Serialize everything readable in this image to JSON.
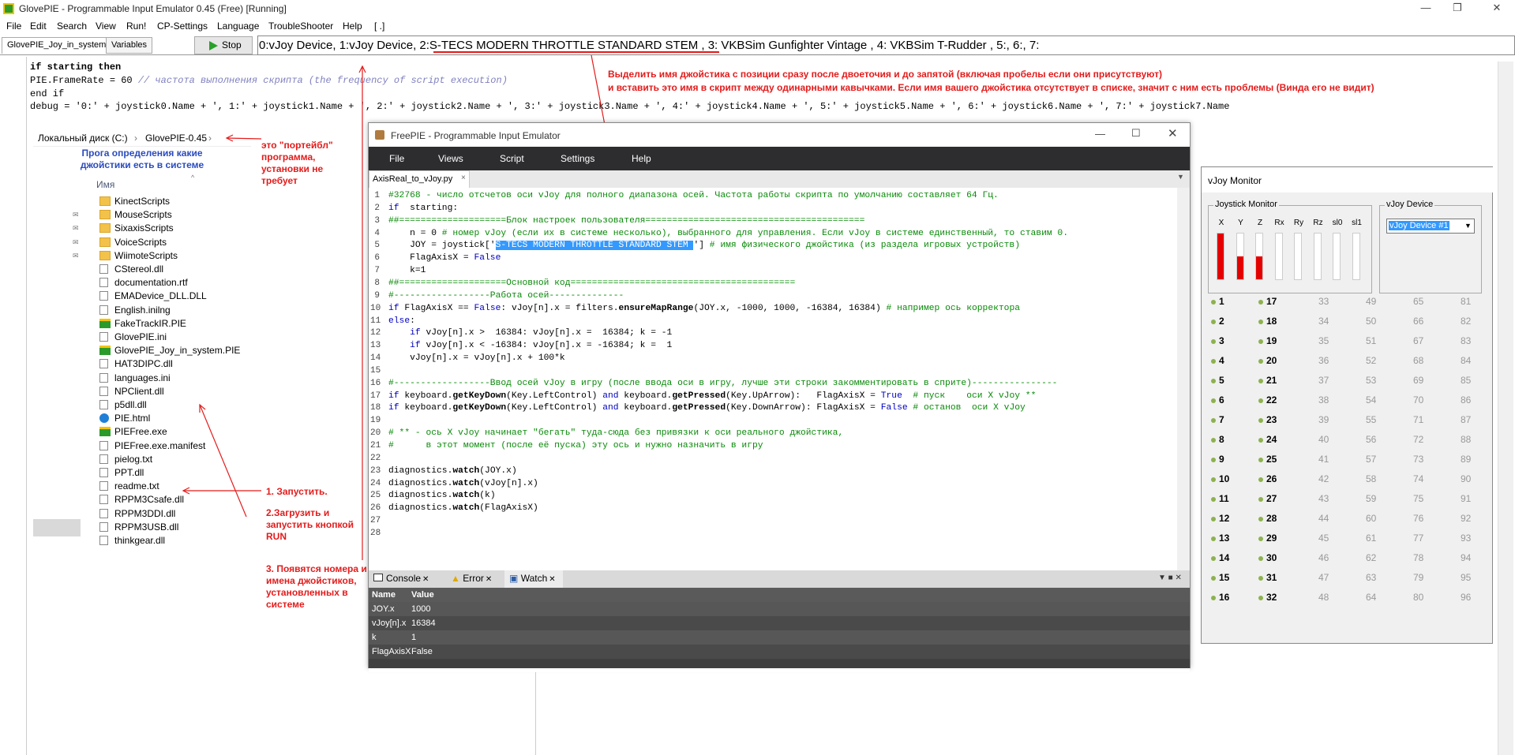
{
  "app": {
    "title": "GlovePIE - Programmable Input Emulator 0.45 (Free) [Running]",
    "menu": [
      "File",
      "Edit",
      "Search",
      "View",
      "Run!",
      "CP-Settings",
      "Language",
      "TroubleShooter",
      "Help",
      "[ .]"
    ],
    "tabs": [
      "GlovePIE_Joy_in_system",
      "Variables"
    ],
    "stop_label": "Stop",
    "debug_output": "0:vJoy Device, 1:vJoy Device, 2:S-TECS MODERN THROTTLE STANDARD STEM , 3: VKBSim Gunfighter Vintage , 4: VKBSim T-Rudder , 5:, 6:, 7:",
    "script_lines": [
      "if starting then",
      "PIE.FrameRate = 60 // частота выполнения скрипта (the frequency of script execution)",
      "end if",
      "debug = '0:' + joystick0.Name + ', 1:' + joystick1.Name + ', 2:' + joystick2.Name + ', 3:' + joystick3.Name + ', 4:' + joystick4.Name + ', 5:' + joystick5.Name + ', 6:' + joystick6.Name + ', 7:' + joystick7.Name"
    ]
  },
  "explorer": {
    "breadcrumb": [
      "Локальный диск (C:)",
      "GlovePIE-0.45"
    ],
    "column_header": "Имя",
    "items": [
      "KinectScripts",
      "MouseScripts",
      "SixaxisScripts",
      "VoiceScripts",
      "WiimoteScripts",
      "CStereol.dll",
      "documentation.rtf",
      "EMADevice_DLL.DLL",
      "English.inilng",
      "FakeTrackIR.PIE",
      "GlovePIE.ini",
      "GlovePIE_Joy_in_system.PIE",
      "HAT3DIPC.dll",
      "languages.ini",
      "NPClient.dll",
      "p5dll.dll",
      "PIE.html",
      "PIEFree.exe",
      "PIEFree.exe.manifest",
      "pielog.txt",
      "PPT.dll",
      "readme.txt",
      "RPPM3Csafe.dll",
      "RPPM3DDI.dll",
      "RPPM3USB.dll",
      "thinkgear.dll"
    ]
  },
  "annotations": {
    "blue_note": "Прога определения какие джойстики есть в системе",
    "portable": "это \"портейбл\" программа, установки не требует",
    "step1": "1. Запустить.",
    "step2": "2.Загрузить и запустить кнопкой RUN",
    "step3": "3. Появятся номера и имена джойстиков, установленных в системе",
    "top_line1": "Выделить имя джойстика с позиции сразу после двоеточия и до запятой (включая пробелы если они присутствуют)",
    "top_line2": "и вставить это имя в скрипт между одинарными кавычками. Если имя вашего джойстика отсутствует в списке, значит с ним есть проблемы (Винда его не видит)"
  },
  "freepie": {
    "title": "FreePIE - Programmable Input Emulator",
    "menu": [
      "File",
      "Views",
      "Script",
      "Settings",
      "Help"
    ],
    "tab": "AxisReal_to_vJoy.py",
    "close": "×",
    "bottom_tabs": [
      "Console",
      "Error",
      "Watch"
    ],
    "watch_headers": [
      "Name",
      "Value"
    ],
    "watch_rows": [
      [
        "JOY.x",
        "1000"
      ],
      [
        "vJoy[n].x",
        "16384"
      ],
      [
        "k",
        "1"
      ],
      [
        "FlagAxisX",
        "False"
      ]
    ]
  },
  "vjoy": {
    "title": "vJoy Monitor",
    "joystick_monitor": "Joystick Monitor",
    "vjoy_device": "vJoy Device",
    "device_selected": "vJoy Device #1",
    "axes": [
      "X",
      "Y",
      "Z",
      "Rx",
      "Ry",
      "Rz",
      "sl0",
      "sl1"
    ],
    "axis_levels": [
      1.0,
      0.5,
      0.5,
      0,
      0,
      0,
      0,
      0
    ],
    "buttons": [
      1,
      2,
      3,
      4,
      5,
      6,
      7,
      8,
      9,
      10,
      11,
      12,
      13,
      14,
      15,
      16,
      17,
      18,
      19,
      20,
      21,
      22,
      23,
      24,
      25,
      26,
      27,
      28,
      29,
      30,
      31,
      32,
      33,
      34,
      35,
      36,
      37,
      38,
      39,
      40,
      41,
      42,
      43,
      44,
      45,
      46,
      47,
      48,
      49,
      50,
      51,
      52,
      53,
      54,
      55,
      56,
      57,
      58,
      59,
      60,
      61,
      62,
      63,
      64,
      65,
      66,
      67,
      68,
      69,
      70,
      71,
      72,
      73,
      74,
      75,
      76,
      77,
      78,
      79,
      80,
      81,
      82,
      83,
      84,
      85,
      86,
      87,
      88,
      89,
      90,
      91,
      92,
      93,
      94,
      95,
      96
    ]
  }
}
